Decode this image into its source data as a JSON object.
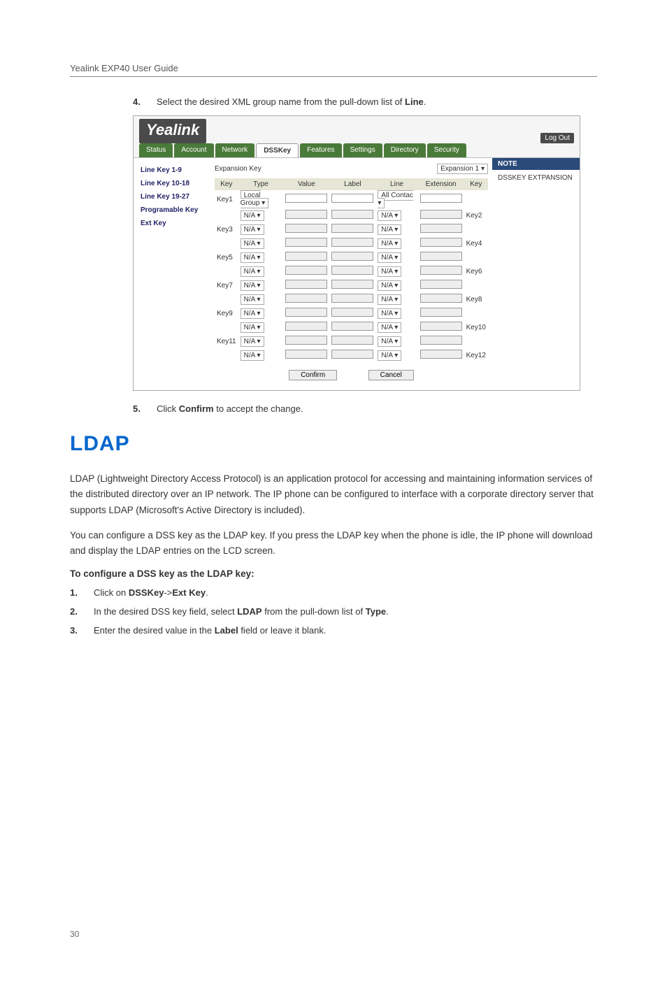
{
  "header": {
    "guide_title": "Yealink EXP40 User Guide"
  },
  "page_number": "30",
  "steps": {
    "s4": {
      "num": "4.",
      "pre": "Select the desired XML group name from the pull-down list of ",
      "bold": "Line",
      "post": "."
    },
    "s5": {
      "num": "5.",
      "pre": "Click ",
      "bold": "Confirm",
      "post": " to accept the change."
    }
  },
  "section_title": "LDAP",
  "paragraphs": {
    "p1": "LDAP (Lightweight Directory Access Protocol) is an application protocol for accessing and maintaining information services of the distributed directory over an IP network. The IP phone can be configured to interface with a corporate directory server that supports LDAP (Microsoft's Active Directory is included).",
    "p2": "You can configure a DSS key as the LDAP key. If you press the LDAP key when the phone is idle, the IP phone will download and display the LDAP entries on the LCD screen."
  },
  "config_head": "To configure a DSS key as the LDAP key:",
  "config_steps": {
    "c1": {
      "num": "1.",
      "t1": "Click on ",
      "b1": "DSSKey",
      "t2": "->",
      "b2": "Ext Key",
      "t3": "."
    },
    "c2": {
      "num": "2.",
      "t1": "In the desired DSS key field, select ",
      "b1": "LDAP",
      "t2": " from the pull-down list of ",
      "b2": "Type",
      "t3": "."
    },
    "c3": {
      "num": "3.",
      "t1": "Enter the desired value in the ",
      "b1": "Label",
      "t2": " field or leave it blank.",
      "b2": "",
      "t3": ""
    }
  },
  "screenshot": {
    "brand": "Yealink",
    "logout": "Log Out",
    "tabs": [
      "Status",
      "Account",
      "Network",
      "DSSKey",
      "Features",
      "Settings",
      "Directory",
      "Security"
    ],
    "active_tab_index": 3,
    "sidebar": [
      "Line Key 1-9",
      "Line Key 10-18",
      "Line Key 19-27",
      "Programable Key",
      "Ext Key"
    ],
    "expansion_label": "Expansion Key",
    "expansion_sel_label": "Expansion 1",
    "table_headers": [
      "Key",
      "Type",
      "Value",
      "Label",
      "Line",
      "Extension",
      "Key"
    ],
    "rows": [
      {
        "keyL": "Key1",
        "type": "Local Group",
        "line": "All Contac",
        "keyR": "",
        "disabled": false
      },
      {
        "keyL": "",
        "type": "N/A",
        "line": "N/A",
        "keyR": "Key2",
        "disabled": true
      },
      {
        "keyL": "Key3",
        "type": "N/A",
        "line": "N/A",
        "keyR": "",
        "disabled": true
      },
      {
        "keyL": "",
        "type": "N/A",
        "line": "N/A",
        "keyR": "Key4",
        "disabled": true
      },
      {
        "keyL": "Key5",
        "type": "N/A",
        "line": "N/A",
        "keyR": "",
        "disabled": true
      },
      {
        "keyL": "",
        "type": "N/A",
        "line": "N/A",
        "keyR": "Key6",
        "disabled": true
      },
      {
        "keyL": "Key7",
        "type": "N/A",
        "line": "N/A",
        "keyR": "",
        "disabled": true
      },
      {
        "keyL": "",
        "type": "N/A",
        "line": "N/A",
        "keyR": "Key8",
        "disabled": true
      },
      {
        "keyL": "Key9",
        "type": "N/A",
        "line": "N/A",
        "keyR": "",
        "disabled": true
      },
      {
        "keyL": "",
        "type": "N/A",
        "line": "N/A",
        "keyR": "Key10",
        "disabled": true
      },
      {
        "keyL": "Key11",
        "type": "N/A",
        "line": "N/A",
        "keyR": "",
        "disabled": true
      },
      {
        "keyL": "",
        "type": "N/A",
        "line": "N/A",
        "keyR": "Key12",
        "disabled": true
      }
    ],
    "note_head": "NOTE",
    "note_body": "DSSKEY EXTPANSION",
    "confirm": "Confirm",
    "cancel": "Cancel"
  }
}
